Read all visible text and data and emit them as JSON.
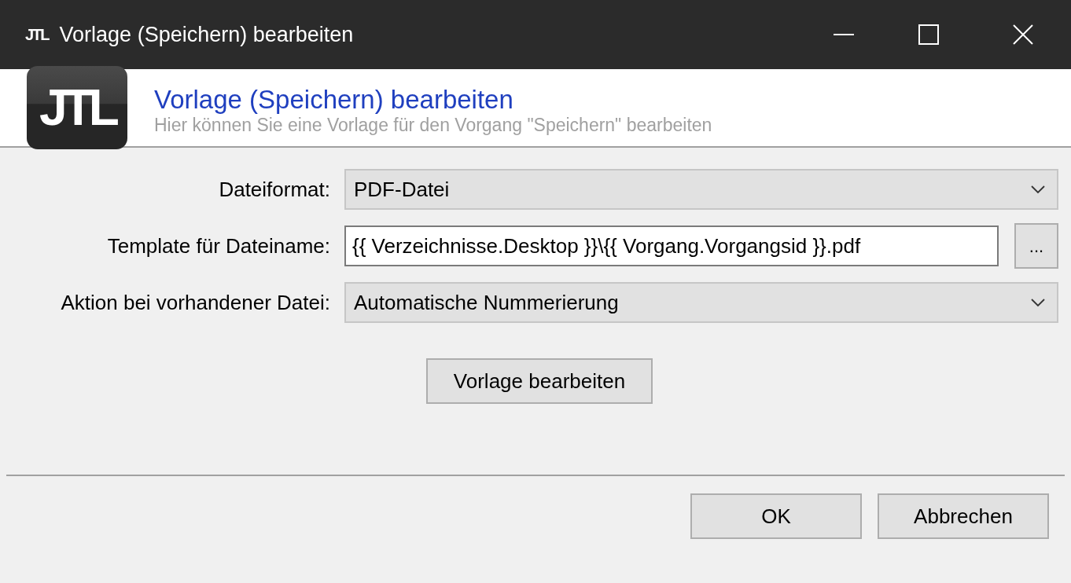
{
  "window": {
    "logo_text": "JTL",
    "title": "Vorlage (Speichern) bearbeiten"
  },
  "header": {
    "logo_text": "JTL",
    "title": "Vorlage (Speichern) bearbeiten",
    "subtitle": "Hier können Sie eine Vorlage für den Vorgang \"Speichern\" bearbeiten"
  },
  "fields": [
    {
      "kind": "select",
      "label": "Dateiformat:",
      "value": "PDF-Datei"
    },
    {
      "kind": "text",
      "label": "Template für Dateiname:",
      "value": "{{ Verzeichnisse.Desktop }}\\{{ Vorgang.Vorgangsid }}.pdf",
      "browse_button": "..."
    },
    {
      "kind": "select",
      "label": "Aktion bei vorhandener Datei:",
      "value": "Automatische Nummerierung"
    }
  ],
  "edit_button": "Vorlage bearbeiten",
  "buttons": [
    "OK",
    "Abbrechen"
  ]
}
